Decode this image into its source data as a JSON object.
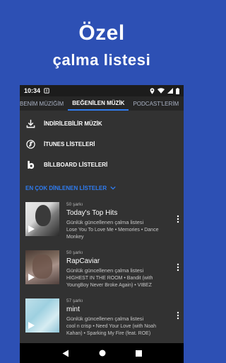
{
  "promo": {
    "title_line1": "Özel",
    "title_line2": "çalma listesi"
  },
  "status_bar": {
    "time": "10:34",
    "icons": [
      "location-icon",
      "wifi-icon",
      "signal-icon",
      "battery-icon"
    ]
  },
  "tabs": [
    {
      "label": "BENİM MÜZİĞİM",
      "active": false
    },
    {
      "label": "BEĞENİLEN MÜZİK",
      "active": true
    },
    {
      "label": "PODCAST'LERİM",
      "active": false
    }
  ],
  "menu": {
    "items": [
      {
        "label": "İNDİRİLEBİLİR MÜZİK",
        "icon": "download-icon"
      },
      {
        "label": "İTUNES LİSTELERİ",
        "icon": "music-note-icon"
      },
      {
        "label": "BİLLBOARD LİSTELERİ",
        "icon": "billboard-b-icon"
      }
    ]
  },
  "section": {
    "label": "EN ÇOK DİNLENEN LİSTELER",
    "icon": "chevron-down-icon"
  },
  "playlists": [
    {
      "count": "50 şarkı",
      "name": "Today's Top Hits",
      "description": "Günlük güncellenen çalma listesi",
      "tracks": "Lose You To Love Me • Memories • Dance Monkey"
    },
    {
      "count": "50 şarkı",
      "name": "RapCaviar",
      "description": "Günlük güncellenen çalma listesi",
      "tracks": "HIGHEST IN THE ROOM • Bandit (with YoungBoy Never Broke Again) • VIBEZ"
    },
    {
      "count": "57 şarkı",
      "name": "mint",
      "description": "Günlük güncellenen çalma listesi",
      "tracks": "cool n crisp • Need Your Love (with Noah Kahan) • Sparking My Fire (feat. ROE)"
    }
  ],
  "colors": {
    "background": "#2d50b4",
    "accent": "#2f7cf0",
    "panel": "#323232"
  }
}
